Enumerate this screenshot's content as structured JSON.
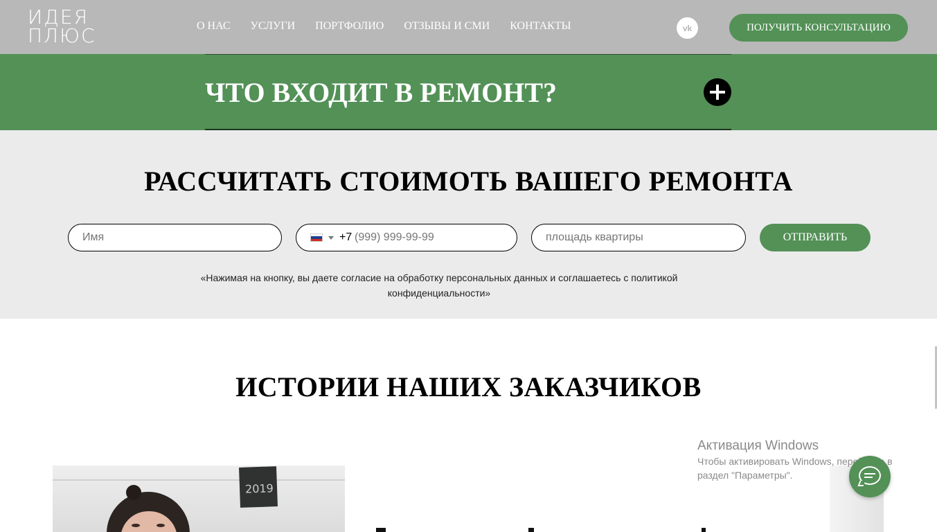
{
  "header": {
    "logo_line1": "ИДЕЯ",
    "logo_line2": "ПЛЮС",
    "nav": [
      "О НАС",
      "УСЛУГИ",
      "ПОРТФОЛИО",
      "ОТЗЫВЫ И СМИ",
      "КОНТАКТЫ"
    ],
    "social_icon": "vk-icon",
    "social_label": "vk",
    "consult_button": "ПОЛУЧИТЬ КОНСУЛЬТАЦИЮ"
  },
  "accordion": {
    "title": "ЧТО ВХОДИТ В РЕМОНТ?",
    "toggle_icon": "plus-icon"
  },
  "calc_form": {
    "title": "РАССЧИТАТЬ СТОИМОТЬ ВАШЕГО РЕМОНТА",
    "name_placeholder": "Имя",
    "phone_code": "+7",
    "phone_placeholder": "(999) 999-99-99",
    "area_placeholder": "площадь квартиры",
    "submit_label": "ОТПРАВИТЬ",
    "consent_text": "«Нажимая на кнопку, вы даете согласие на обработку персональных данных и соглашаетесь с политикой конфиденциальности»"
  },
  "stories": {
    "title": "ИСТОРИИ НАШИХ ЗАКАЗЧИКОВ",
    "photo_sign": "2019"
  },
  "windows_watermark": {
    "title": "Активация Windows",
    "subtitle": "Чтобы активировать Windows, перейдите в раздел \"Параметры\"."
  },
  "colors": {
    "accent": "#539157",
    "header_bg": "#b8b8b8",
    "form_bg": "#ebebeb"
  }
}
